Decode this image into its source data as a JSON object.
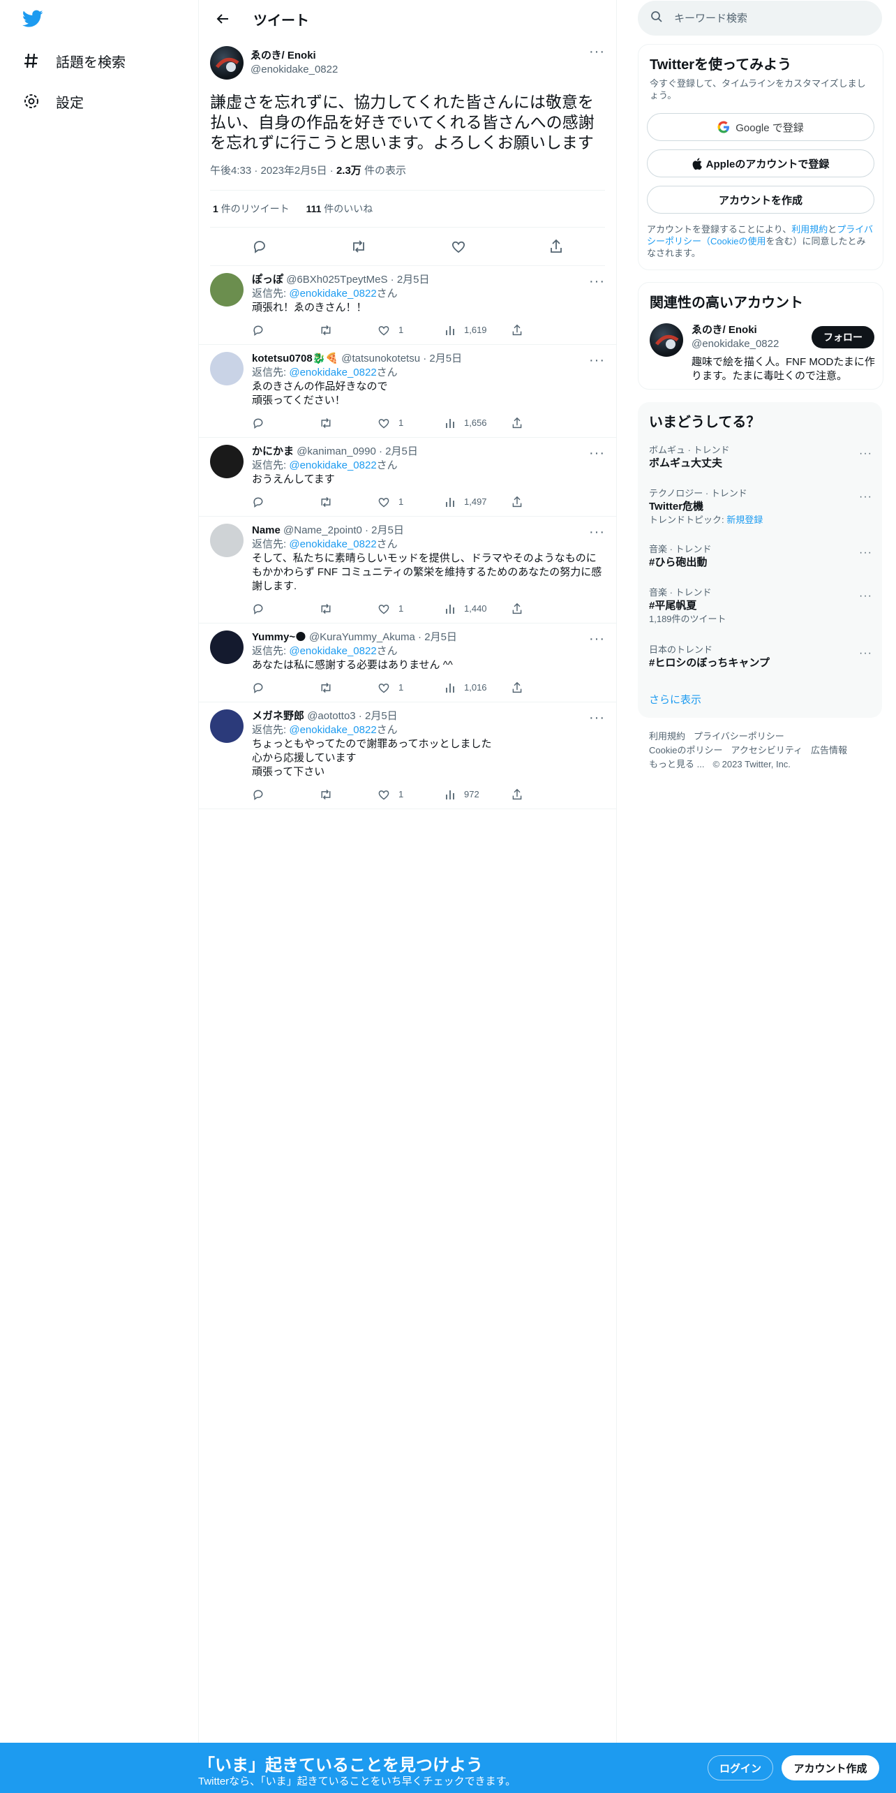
{
  "nav": {
    "explore_label": "話題を検索",
    "settings_label": "設定"
  },
  "header": {
    "title": "ツイート"
  },
  "tweet": {
    "display_name": "ゑのき/ Enoki",
    "handle": "@enokidake_0822",
    "text": "謙虚さを忘れずに、協力してくれた皆さんには敬意を払い、自身の作品を好きでいてくれる皆さんへの感謝を忘れずに行こうと思います。よろしくお願いします",
    "time": "午後4:33",
    "date": "2023年2月5日",
    "views_count": "2.3万",
    "views_label": "件の表示",
    "retweets_count": "1",
    "retweets_label": "件のリツイート",
    "likes_count": "111",
    "likes_label": "件のいいね"
  },
  "replies": [
    {
      "display_name": "ぽっぽ",
      "handle": "@6BXh025TpeytMeS",
      "date": "2月5日",
      "reply_to_prefix": "返信先: ",
      "reply_to_handle": "@enokidake_0822",
      "reply_to_suffix": "さん",
      "text": "頑張れ！ゑのきさん！！",
      "likes": "1",
      "views": "1,619",
      "avatar_color": "#6b8e4e"
    },
    {
      "display_name": "kotetsu0708🐉🍕",
      "handle": "@tatsunokotetsu",
      "date": "2月5日",
      "reply_to_prefix": "返信先: ",
      "reply_to_handle": "@enokidake_0822",
      "reply_to_suffix": "さん",
      "text": "ゑのきさんの作品好きなので\n頑張ってください！",
      "likes": "1",
      "views": "1,656",
      "avatar_color": "#c9d3e6"
    },
    {
      "display_name": "かにかま",
      "handle": "@kaniman_0990",
      "date": "2月5日",
      "reply_to_prefix": "返信先: ",
      "reply_to_handle": "@enokidake_0822",
      "reply_to_suffix": "さん",
      "text": "おうえんしてます",
      "likes": "1",
      "views": "1,497",
      "avatar_color": "#1a1a1a"
    },
    {
      "display_name": "Name",
      "handle": "@Name_2point0",
      "date": "2月5日",
      "reply_to_prefix": "返信先: ",
      "reply_to_handle": "@enokidake_0822",
      "reply_to_suffix": "さん",
      "text": "そして、私たちに素晴らしいモッドを提供し、ドラマやそのようなものにもかかわらず FNF コミュニティの繁栄を維持するためのあなたの努力に感謝します.",
      "likes": "1",
      "views": "1,440",
      "avatar_color": "#cfd3d6"
    },
    {
      "display_name": "Yummy~🌑",
      "handle": "@KuraYummy_Akuma",
      "date": "2月5日",
      "reply_to_prefix": "返信先: ",
      "reply_to_handle": "@enokidake_0822",
      "reply_to_suffix": "さん",
      "text": "あなたは私に感謝する必要はありません ^^",
      "likes": "1",
      "views": "1,016",
      "avatar_color": "#141a2e"
    },
    {
      "display_name": "メガネ野郎",
      "handle": "@aototto3",
      "date": "2月5日",
      "reply_to_prefix": "返信先: ",
      "reply_to_handle": "@enokidake_0822",
      "reply_to_suffix": "さん",
      "text": "ちょっともやってたので謝罪あってホッとしました\n心から応援しています\n頑張って下さい",
      "likes": "1",
      "views": "972",
      "avatar_color": "#2b3a7a"
    }
  ],
  "search": {
    "placeholder": "キーワード検索"
  },
  "signup_card": {
    "title": "Twitterを使ってみよう",
    "subtitle": "今すぐ登録して、タイムラインをカスタマイズしましょう。",
    "google_label": "Google で登録",
    "apple_label": "Appleのアカウントで登録",
    "create_label": "アカウントを作成",
    "legal_prefix": "アカウントを登録することにより、",
    "legal_terms": "利用規約",
    "legal_and": "と",
    "legal_privacy": "プライバシーポリシー",
    "legal_open": "（",
    "legal_cookie": "Cookieの使用",
    "legal_suffix": "を含む）に同意したとみなされます。"
  },
  "relevant_card": {
    "title": "関連性の高いアカウント",
    "display_name": "ゑのき/ Enoki",
    "handle": "@enokidake_0822",
    "follow_label": "フォロー",
    "bio": "趣味で絵を描く人。FNF MODたまに作ります。たまに毒吐くので注意。"
  },
  "trends_card": {
    "title": "いまどうしてる？",
    "items": [
      {
        "category": "ボムギュ · トレンド",
        "name": "ボムギュ大丈夫",
        "extra": ""
      },
      {
        "category": "テクノロジー · トレンド",
        "name": "Twitter危機",
        "extra_prefix": "トレンドトピック: ",
        "extra_link": "新規登録"
      },
      {
        "category": "音楽 · トレンド",
        "name": "#ひら砲出動",
        "extra": ""
      },
      {
        "category": "音楽 · トレンド",
        "name": "#平尾帆夏",
        "extra": "1,189件のツイート"
      },
      {
        "category": "日本のトレンド",
        "name": "#ヒロシのぼっちキャンプ",
        "extra": ""
      }
    ],
    "show_more": "さらに表示"
  },
  "footer": {
    "links": [
      "利用規約",
      "プライバシーポリシー",
      "Cookieのポリシー",
      "アクセシビリティ",
      "広告情報",
      "もっと見る ..."
    ],
    "copyright": "© 2023 Twitter, Inc."
  },
  "bottom_bar": {
    "title": "「いま」起きていることを見つけよう",
    "subtitle": "Twitterなら、「いま」起きていることをいち早くチェックできます。",
    "login_label": "ログイン",
    "signup_label": "アカウント作成"
  },
  "colors": {
    "accent": "#1d9bf0",
    "text": "#0f1419",
    "muted": "#536471",
    "border": "#eff3f4"
  }
}
